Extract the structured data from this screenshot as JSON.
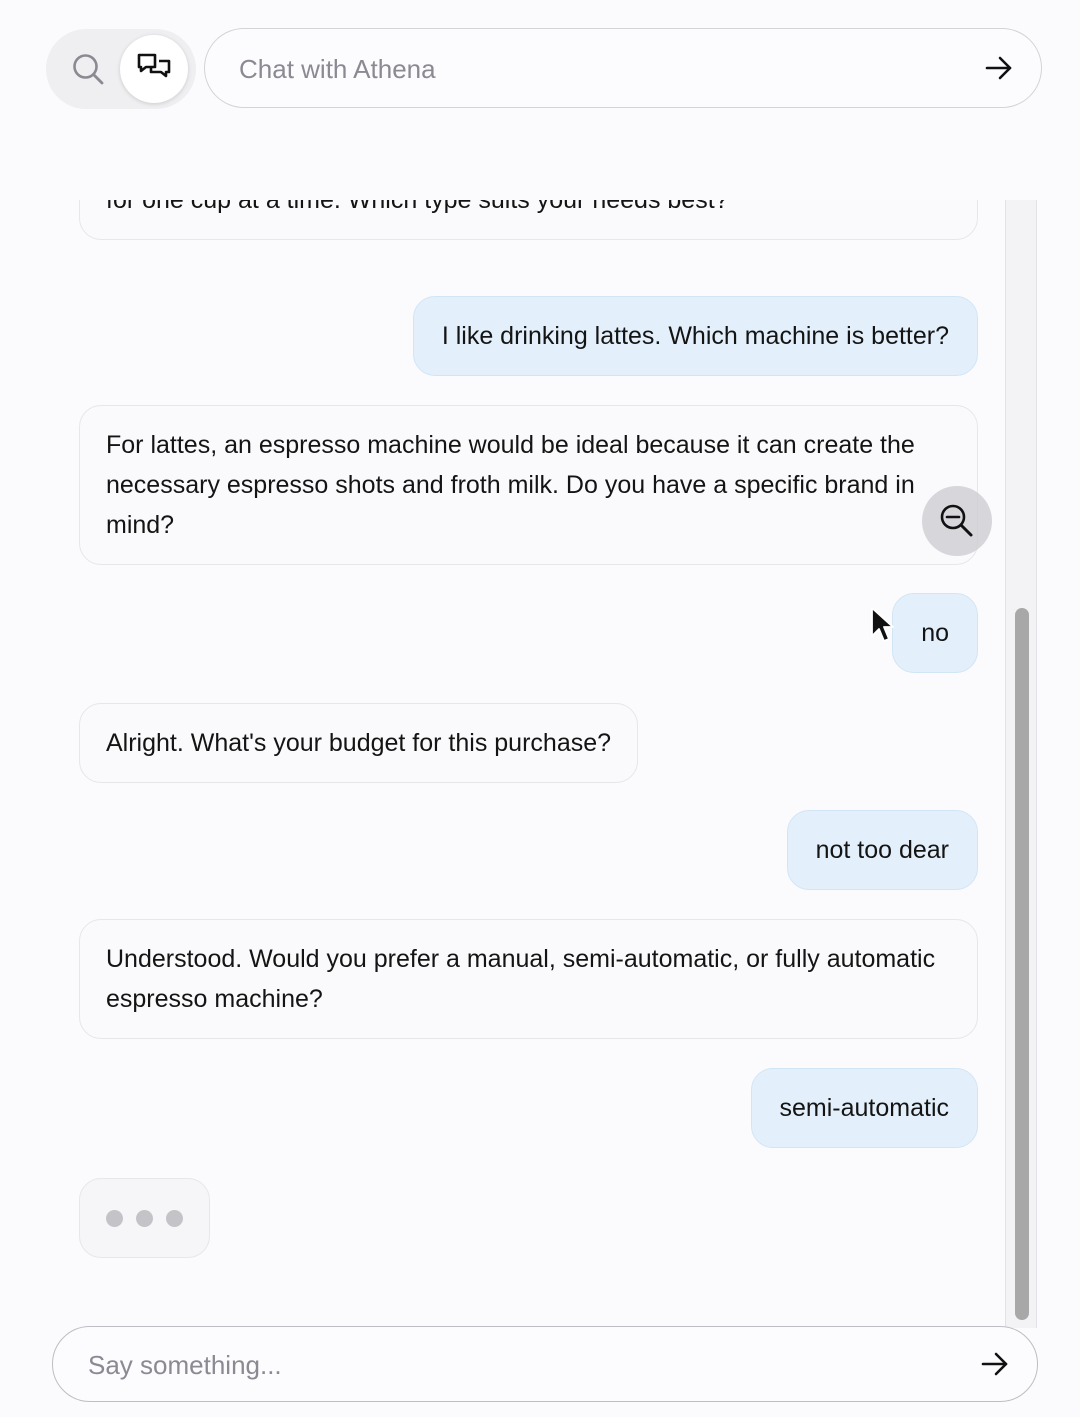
{
  "header": {
    "search_mode_icon": "search-icon",
    "chat_mode_icon": "chat-bubbles-icon",
    "search_placeholder": "Chat with Athena",
    "submit_icon": "arrow-right-icon"
  },
  "messages": [
    {
      "role": "assistant",
      "text": "for one cup at a time. Which type suits your needs best?"
    },
    {
      "role": "user",
      "text": "I like drinking lattes. Which machine is better?"
    },
    {
      "role": "assistant",
      "text": "For lattes, an espresso machine would be ideal because it can create the necessary espresso shots and froth milk. Do you have a specific brand in mind?"
    },
    {
      "role": "user",
      "text": "no"
    },
    {
      "role": "assistant",
      "text": "Alright. What's your budget for this purchase?"
    },
    {
      "role": "user",
      "text": "not too dear"
    },
    {
      "role": "assistant",
      "text": "Understood. Would you prefer a manual, semi-automatic, or fully automatic espresso machine?"
    },
    {
      "role": "user",
      "text": "semi-automatic"
    }
  ],
  "typing_indicator": {
    "dots": 3
  },
  "overlay": {
    "zoom_icon": "zoom-out-icon",
    "cursor_icon": "mouse-pointer-icon"
  },
  "composer": {
    "placeholder": "Say something...",
    "submit_icon": "arrow-right-icon"
  },
  "colors": {
    "user_bubble": "#e3f0fb",
    "assistant_bubble": "#fafafc",
    "scroll_thumb": "#a8a8a8"
  }
}
